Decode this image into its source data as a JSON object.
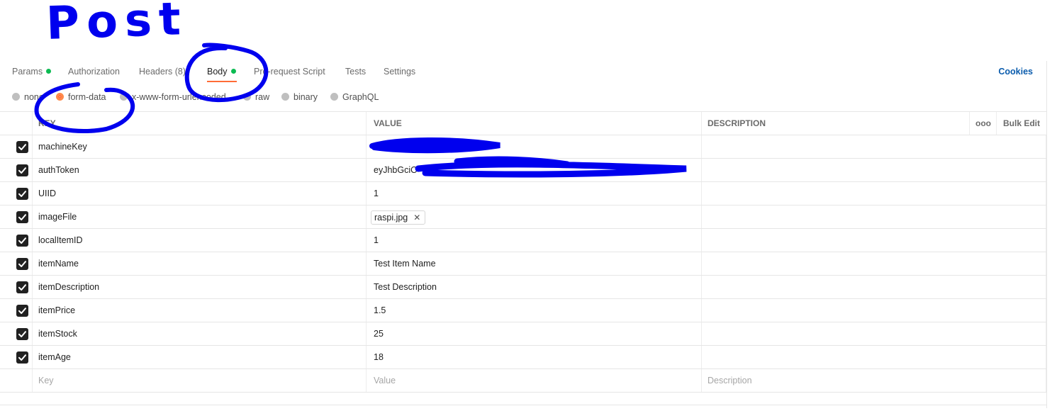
{
  "annotation": {
    "text": "Post"
  },
  "tabs": [
    {
      "label": "Params",
      "dot": true
    },
    {
      "label": "Authorization",
      "dot": false
    },
    {
      "label": "Headers (8)",
      "dot": false
    },
    {
      "label": "Body",
      "dot": true,
      "active": true
    },
    {
      "label": "Pre-request Script",
      "dot": false
    },
    {
      "label": "Tests",
      "dot": false
    },
    {
      "label": "Settings",
      "dot": false
    }
  ],
  "cookies_label": "Cookies",
  "body_types": [
    {
      "label": "none",
      "checked": false
    },
    {
      "label": "form-data",
      "checked": true
    },
    {
      "label": "x-www-form-urlencoded",
      "checked": false
    },
    {
      "label": "raw",
      "checked": false
    },
    {
      "label": "binary",
      "checked": false
    },
    {
      "label": "GraphQL",
      "checked": false
    }
  ],
  "table": {
    "headers": {
      "key": "KEY",
      "value": "VALUE",
      "description": "DESCRIPTION",
      "more": "ooo",
      "bulk_edit": "Bulk Edit"
    },
    "rows": [
      {
        "key": "machineKey",
        "value": "",
        "checked": true
      },
      {
        "key": "authToken",
        "value": "eyJhbGciO",
        "checked": true
      },
      {
        "key": "UIID",
        "value": "1",
        "checked": true
      },
      {
        "key": "imageFile",
        "value": "raspi.jpg",
        "checked": true,
        "file": true
      },
      {
        "key": "localItemID",
        "value": "1",
        "checked": true
      },
      {
        "key": "itemName",
        "value": "Test Item Name",
        "checked": true
      },
      {
        "key": "itemDescription",
        "value": "Test Description",
        "checked": true
      },
      {
        "key": "itemPrice",
        "value": "1.5",
        "checked": true
      },
      {
        "key": "itemStock",
        "value": "25",
        "checked": true
      },
      {
        "key": "itemAge",
        "value": "18",
        "checked": true
      }
    ],
    "new_row": {
      "key_placeholder": "Key",
      "value_placeholder": "Value",
      "description_placeholder": "Description"
    }
  },
  "colors": {
    "accent": "#ff6c37",
    "dot": "#0cbb52",
    "link": "#0b5cad",
    "annotation": "#0000ee"
  }
}
